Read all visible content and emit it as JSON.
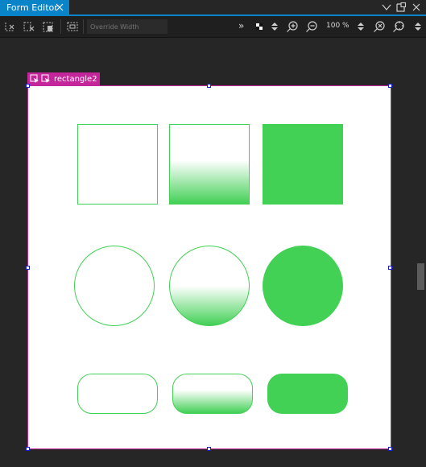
{
  "tab": {
    "title": "Form Editor"
  },
  "window_icons": [
    "chevron-down-icon",
    "detach-icon",
    "close-icon"
  ],
  "toolbar": {
    "override_width_placeholder": "Override Width",
    "zoom_value": "100 %",
    "overflow_label": "»"
  },
  "selection": {
    "item_id": "rectangle2"
  },
  "colors": {
    "accent": "#0a84c8",
    "selection": "#c5259a",
    "handle": "#1c1ccf",
    "shape_green": "#42d055",
    "form_bg": "#ffffff",
    "editor_bg": "#262626"
  },
  "shapes": [
    {
      "kind": "rectangle",
      "style": "outline"
    },
    {
      "kind": "rectangle",
      "style": "gradient"
    },
    {
      "kind": "rectangle",
      "style": "filled"
    },
    {
      "kind": "circle",
      "style": "outline"
    },
    {
      "kind": "circle",
      "style": "gradient"
    },
    {
      "kind": "circle",
      "style": "filled"
    },
    {
      "kind": "rounded-rectangle",
      "style": "outline"
    },
    {
      "kind": "rounded-rectangle",
      "style": "gradient"
    },
    {
      "kind": "rounded-rectangle",
      "style": "filled"
    }
  ]
}
